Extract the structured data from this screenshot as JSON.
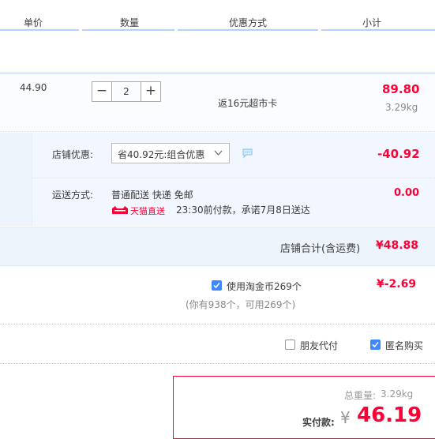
{
  "header": {
    "col_price": "单价",
    "col_qty": "数量",
    "col_discount": "优惠方式",
    "col_subtotal": "小计"
  },
  "item": {
    "unit_price": "44.90",
    "quantity": "2",
    "minus": "−",
    "plus": "+",
    "promo": "返16元超市卡",
    "subtotal": "89.80",
    "weight": "3.29kg"
  },
  "shop": {
    "discount_label": "店铺优惠:",
    "discount_select": "省40.92元:组合优惠",
    "discount_amount": "-40.92",
    "shipping_label": "运送方式:",
    "shipping_method": "普通配送 快递 免邮",
    "tmall_badge": "天猫直送",
    "shipping_promise": "23:30前付款，承诺7月8日送达",
    "shipping_amount": "0.00",
    "total_label": "店铺合计(含运费)",
    "total_amount": "¥48.88"
  },
  "coins": {
    "label": "使用淘金币269个",
    "checked": true,
    "amount": "¥-2.69",
    "note": "(你有938个，可用269个)"
  },
  "options": {
    "friend_pay": "朋友代付",
    "friend_pay_checked": false,
    "anonymous": "匿名购买",
    "anonymous_checked": true
  },
  "summary": {
    "weight_label": "总重量:",
    "weight_value": "3.29kg",
    "pay_label": "实付款:",
    "currency": "¥",
    "pay_amount": "46.19"
  },
  "colors": {
    "accent_red": "#ff0036",
    "check_blue": "#3e87ff",
    "panel_blue": "#eef4fc"
  }
}
